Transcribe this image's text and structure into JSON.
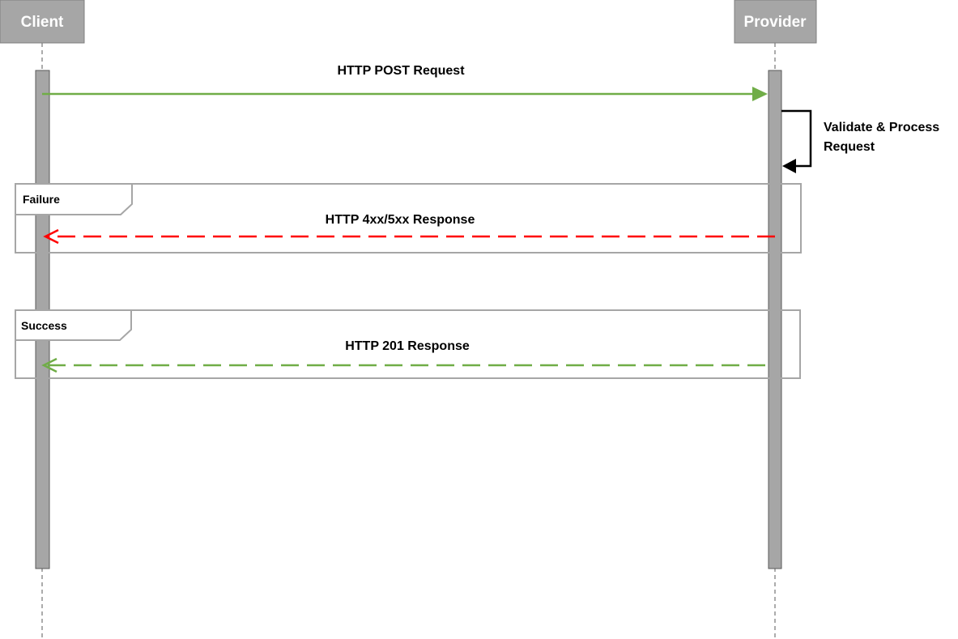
{
  "participants": {
    "client": {
      "label": "Client"
    },
    "provider": {
      "label": "Provider"
    }
  },
  "messages": {
    "request": {
      "label": "HTTP POST Request",
      "color": "#70ad47"
    },
    "self_call": {
      "label_line1": "Validate & Process",
      "label_line2": "Request",
      "color": "#000000"
    },
    "failure_response": {
      "label": "HTTP 4xx/5xx Response",
      "color": "#ff0000"
    },
    "success_response": {
      "label": "HTTP 201 Response",
      "color": "#70ad47"
    }
  },
  "frames": {
    "failure": {
      "label": "Failure"
    },
    "success": {
      "label": "Success"
    }
  }
}
